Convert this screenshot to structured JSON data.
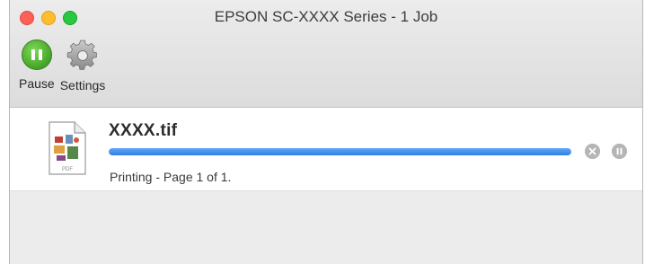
{
  "window": {
    "title": "EPSON SC-XXXX Series - 1 Job"
  },
  "toolbar": {
    "pause_label": "Pause",
    "settings_label": "Settings"
  },
  "job": {
    "name": "XXXX.tif",
    "status": "Printing - Page 1 of 1.",
    "progress_fraction": 1.0,
    "icon_caption": "PDF"
  },
  "colors": {
    "pause_green": "#45a329",
    "progress_blue": "#2e7fe6",
    "close": "#fe5f57",
    "minimize": "#febc2e",
    "maximize": "#28c840"
  },
  "icons": [
    "close-window",
    "minimize-window",
    "maximize-window",
    "pause-icon",
    "gear-icon",
    "document-icon",
    "cancel-icon",
    "pause-job-icon"
  ]
}
